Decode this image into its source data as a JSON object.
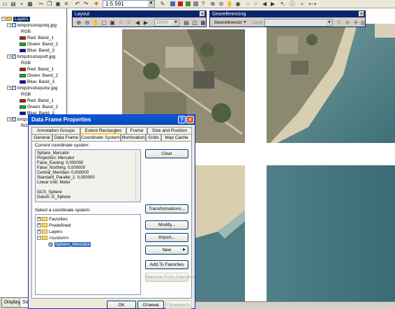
{
  "toolbar": {
    "scale_value": "1:5 591"
  },
  "toc": {
    "root_label": "Layers",
    "layers": [
      {
        "name": "brtqstrsstsqsxtq.jpg",
        "rgb": "RGB",
        "bands": [
          "Red:   Band_1",
          "Green: Band_2",
          "Blue:  Band_3"
        ]
      },
      {
        "name": "brtqstrsstsqsxtt.jpg",
        "rgb": "RGB",
        "bands": [
          "Red:   Band_1",
          "Green: Band_2",
          "Blue:  Band_3"
        ]
      },
      {
        "name": "brtqstrsstsqsxtsr.jpg",
        "rgb": "RGB",
        "bands": [
          "Red:   Band_1",
          "Green: Band_2",
          "Blue:  Band_3"
        ]
      },
      {
        "name": "brtqstrsstsqstss.jpg",
        "rgb": "RGB"
      }
    ],
    "tabs": [
      "Display",
      "Sour"
    ]
  },
  "layout_bar": {
    "title": "Layout",
    "zoom_value": "100%"
  },
  "georef_bar": {
    "title": "Georeferencing",
    "menu_label": "Georeferencing",
    "layer_label": "Layer:"
  },
  "dialog": {
    "title": "Data Frame Properties",
    "tabs_row1": [
      "Annotation Groups",
      "Extent Rectangles",
      "Frame",
      "Size and Position"
    ],
    "tabs_row2": [
      "General",
      "Data Frame",
      "Coordinate System",
      "Illumination",
      "Grids",
      "Map Cache"
    ],
    "current_label": "Current coordinate system:",
    "coord_lines": [
      "Sphere_Mercator",
      "Projection: Mercator",
      "False_Easting: 0,000000",
      "False_Northing: 0,000000",
      "Central_Meridian: 0,000000",
      "Standard_Parallel_1: 0,000000",
      "Linear Unit: Meter",
      "",
      "GCS_Sphere",
      "Datum: D_Sphere"
    ],
    "select_label": "Select a coordinate system:",
    "tree_items": [
      "Favorites",
      "Predefined",
      "Layers",
      "<custom>",
      "Sphere_Mercator"
    ],
    "buttons": {
      "clear": "Clear",
      "transformations": "Transformations...",
      "modify": "Modify...",
      "import": "Import...",
      "new": "New",
      "add_favorites": "Add To Favorites",
      "remove_favorites": "Remove From Favorites"
    },
    "footer": {
      "ok": "OK",
      "cancel": "Отмена",
      "apply": "Применить"
    }
  }
}
